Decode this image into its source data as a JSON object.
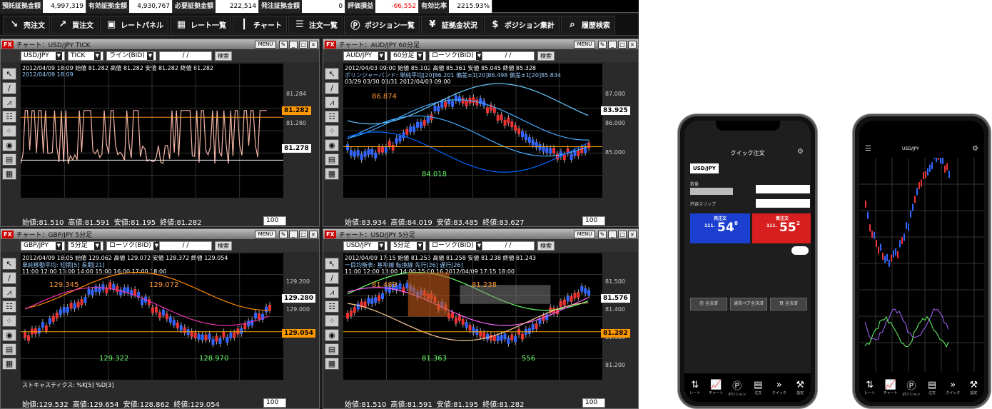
{
  "status": [
    {
      "label": "預託証拠金額",
      "value": "4,997,319",
      "neg": false
    },
    {
      "label": "有効証拠金額",
      "value": "4,930,767",
      "neg": false
    },
    {
      "label": "必要証拠金額",
      "value": "222,514",
      "neg": false
    },
    {
      "label": "発注証拠金額",
      "value": "0",
      "neg": false
    },
    {
      "label": "評価損益",
      "value": "-66,552",
      "neg": true
    },
    {
      "label": "有効比率",
      "value": "2215.93%",
      "neg": false
    }
  ],
  "toolbar": [
    {
      "label": "売注文",
      "icon": "arrow-down-right-icon",
      "glyph": "↘"
    },
    {
      "label": "買注文",
      "icon": "arrow-up-right-icon",
      "glyph": "↗"
    },
    {
      "label": "レートパネル",
      "icon": "panel-icon",
      "glyph": "▣"
    },
    {
      "label": "レート一覧",
      "icon": "table-icon",
      "glyph": "▦"
    },
    {
      "label": "チャート",
      "icon": "candlestick-icon",
      "glyph": "┃"
    },
    {
      "label": "注文一覧",
      "icon": "list-icon",
      "glyph": "☰"
    },
    {
      "label": "ポジション一覧",
      "icon": "p-icon",
      "glyph": "Ⓟ"
    },
    {
      "label": "証拠金状況",
      "icon": "yen-icon",
      "glyph": "¥"
    },
    {
      "label": "ポジション集計",
      "icon": "dollar-icon",
      "glyph": "$"
    },
    {
      "label": "履歴検索",
      "icon": "search-icon",
      "glyph": "⌕"
    }
  ],
  "common": {
    "menu": "MENU",
    "fx": "FX",
    "search": "検索",
    "date": "/ /",
    "zoom": "100"
  },
  "windows": [
    {
      "title": "チャート：USD/JPY TICK",
      "pair": "USD/JPY",
      "period": "TICK",
      "ctype": "ライン(BID)",
      "info1": "2012/04/09 18:09  始値 81.282  高値 81.282  安値 81.282  終値 81.282",
      "info2": "2012/04/09 18:09",
      "info3": "",
      "foot": [
        "始値:81.510",
        "高値:81.591",
        "安値:81.195",
        "終値:81.282"
      ],
      "axis": [
        "81.284",
        "81.280"
      ],
      "tags": [
        {
          "text": "81.282",
          "color": "#ff9900"
        },
        {
          "text": "81.278",
          "color": "#ffffff"
        }
      ],
      "annotations": []
    },
    {
      "title": "チャート：AUD/JPY 60分足",
      "pair": "AUD/JPY",
      "period": "60分足",
      "ctype": "ローソク(BID)",
      "info1": "2012/04/03 09:00  始値 85.102  高値 85.361  安値 85.045  終値 85.328",
      "info2": "ボリンジャーバンド: 単純平均[20]86.201 偏差±1[20]86.498 偏差±1[20]85.834",
      "info3": "03/29        03/30        03/31      2012/04/03 09:00",
      "foot": [
        "始値:83.934",
        "高値:84.019",
        "安値:83.485",
        "終値:83.627"
      ],
      "axis": [
        "87.000",
        "86.000",
        "85.000"
      ],
      "tags": [
        {
          "text": "83.925",
          "color": "#ffffff"
        }
      ],
      "annotations": [
        "86.874",
        "84.018"
      ]
    },
    {
      "title": "チャート：GBP/JPY 5分足",
      "pair": "GBP/JPY",
      "period": "5分足",
      "ctype": "ローソク(BID)",
      "info1": "2012/04/09 18:05  始値 129.062  高値 129.072  安値 128.372  終値 129.054",
      "info2": "単純移動平均: 短期[5]  長期[21]",
      "info3": "11:00   12:00   13:00   14:00   15:00   16:00   17:00   18:00",
      "foot": [
        "始値:129.532",
        "高値:129.654",
        "安値:128.862",
        "終値:129.054"
      ],
      "axis": [
        "129.200",
        "129.000"
      ],
      "tags": [
        {
          "text": "129.280",
          "color": "#ffffff"
        },
        {
          "text": "129.054",
          "color": "#ff9900"
        }
      ],
      "annotations": [
        "129.345",
        "129.322",
        "129.072",
        "128.970"
      ],
      "sub": "ストキャスティクス: %K[5] %D[3]"
    },
    {
      "title": "チャート：USD/JPY 5分足",
      "pair": "USD/JPY",
      "period": "5分足",
      "ctype": "ローソク(BID)",
      "info1": "2012/04/09 17:15  始値 81.253  高値 81.258  安値 81.238  終値 81.243",
      "info2": "一目均衡表: 基準線 転換線 先行[26] 遅行[26]",
      "info3": "11:00 12:00 13:00 14:00 15:00 16 2012/04/09 17:15 18:00",
      "foot": [
        "始値:81.510",
        "高値:81.591",
        "安値:81.195",
        "終値:81.282"
      ],
      "axis": [
        "81.500",
        "81.400",
        "81.300",
        "81.200"
      ],
      "tags": [
        {
          "text": "81.576",
          "color": "#ffffff"
        },
        {
          "text": "81.282",
          "color": "#ff9900"
        }
      ],
      "annotations": [
        "81.489",
        "81.363",
        "81.238",
        "556"
      ]
    }
  ],
  "phone1": {
    "title": "クイック注文",
    "pair": "USD/JPY",
    "sell_label": "売注文",
    "sell_price": "54",
    "sell_sup": "8",
    "sell_prefix": "111.",
    "buy_label": "買注文",
    "buy_price": "55",
    "buy_sup": "2",
    "buy_prefix": "111.",
    "label_qty": "数量",
    "label_slip": "許容スリップ",
    "btn_settle_sell": "売 全決済",
    "btn_settle_all": "通貨ペア全決済",
    "btn_settle_buy": "買 全決済",
    "tabs": [
      {
        "glyph": "⇅",
        "label": "レート"
      },
      {
        "glyph": "📈",
        "label": "チャート"
      },
      {
        "glyph": "Ⓟ",
        "label": "ポジション"
      },
      {
        "glyph": "▤",
        "label": "注文"
      },
      {
        "glyph": "»",
        "label": "クイック"
      },
      {
        "glyph": "⚒",
        "label": "設定"
      }
    ]
  },
  "phone2": {
    "pair": "USD/JPY",
    "tabs": [
      {
        "glyph": "⇅",
        "label": "レート"
      },
      {
        "glyph": "📈",
        "label": "チャート"
      },
      {
        "glyph": "Ⓟ",
        "label": "ポジション"
      },
      {
        "glyph": "▤",
        "label": "注文"
      },
      {
        "glyph": "»",
        "label": "クイック"
      },
      {
        "glyph": "⚒",
        "label": "設定"
      }
    ]
  }
}
